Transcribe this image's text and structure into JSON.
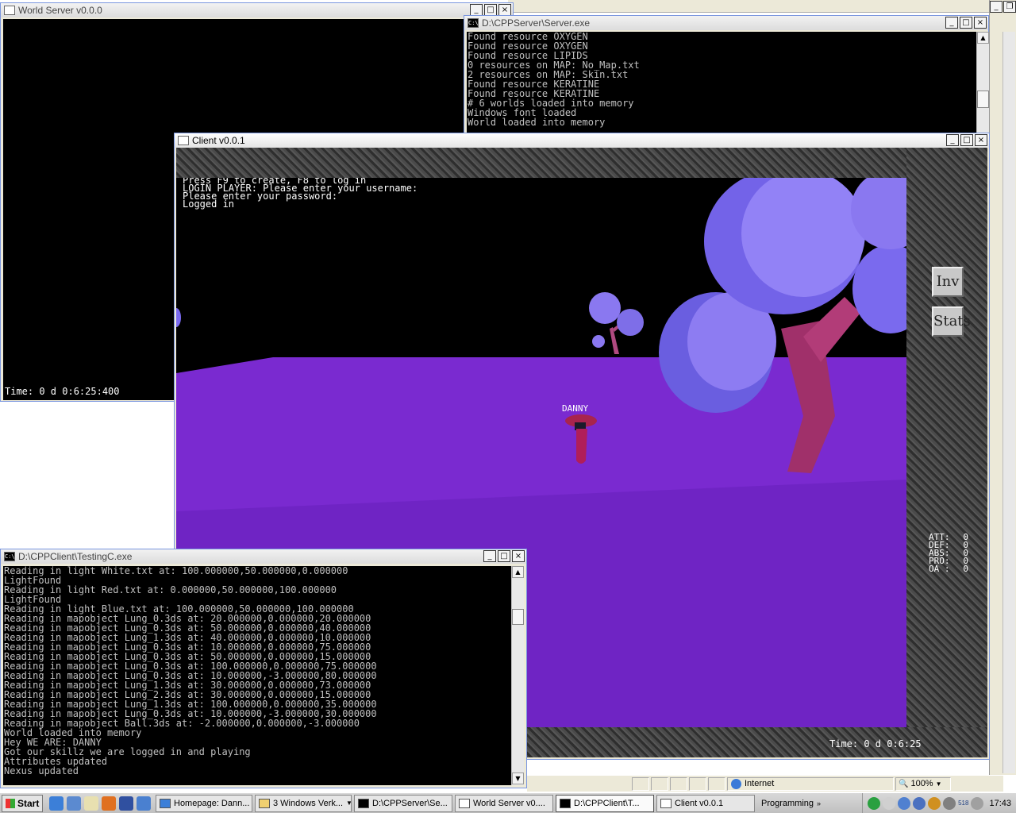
{
  "world_server": {
    "title": "World Server v0.0.0",
    "time_text": "Time: 0 d 0:6:25:400"
  },
  "server": {
    "title": "D:\\CPPServer\\Server.exe",
    "lines": [
      "Found resource OXYGEN",
      "Found resource OXYGEN",
      "Found resource LIPIDS",
      "0 resources on MAP: No_Map.txt",
      "2 resources on MAP: Skin.txt",
      "Found resource KERATINE",
      "Found resource KERATINE",
      "# 6 worlds loaded into memory",
      "Windows font loaded",
      "World loaded into memory"
    ]
  },
  "client": {
    "title": "Client v0.0.1",
    "hud_lines": [
      "Press F9 to create, F8 to log in",
      "Press F9 to create, F8 to log in",
      "LOGIN PLAYER: Please enter your username:",
      "Please enter your password:",
      "Logged in"
    ],
    "player_name": "DANNY",
    "inv_label": "Inv",
    "stats_label": "Stats",
    "stats": [
      {
        "label": "ATT:",
        "value": "0"
      },
      {
        "label": "DEF:",
        "value": "0"
      },
      {
        "label": "ABS:",
        "value": "0"
      },
      {
        "label": "PRO:",
        "value": "0"
      },
      {
        "label": "OA :",
        "value": "0"
      }
    ],
    "time_text": "Time: 0 d 0:6:25"
  },
  "testing_client": {
    "title": "D:\\CPPClient\\TestingC.exe",
    "lines": [
      "Reading in light White.txt at: 100.000000,50.000000,0.000000",
      "LightFound",
      "Reading in light Red.txt at: 0.000000,50.000000,100.000000",
      "LightFound",
      "Reading in light Blue.txt at: 100.000000,50.000000,100.000000",
      "Reading in mapobject Lung_0.3ds at: 20.000000,0.000000,20.000000",
      "Reading in mapobject Lung_0.3ds at: 50.000000,0.000000,40.000000",
      "Reading in mapobject Lung_1.3ds at: 40.000000,0.000000,10.000000",
      "Reading in mapobject Lung_0.3ds at: 10.000000,0.000000,75.000000",
      "Reading in mapobject Lung_0.3ds at: 50.000000,0.000000,15.000000",
      "Reading in mapobject Lung_0.3ds at: 100.000000,0.000000,75.000000",
      "Reading in mapobject Lung_0.3ds at: 10.000000,-3.000000,80.000000",
      "Reading in mapobject Lung_1.3ds at: 30.000000,0.000000,73.000000",
      "Reading in mapobject Lung_2.3ds at: 30.000000,0.000000,15.000000",
      "Reading in mapobject Lung_1.3ds at: 100.000000,0.000000,35.000000",
      "Reading in mapobject Lung_0.3ds at: 10.000000,-3.000000,30.000000",
      "Reading in mapobject Ball.3ds at: -2.000000,0.000000,-3.000000",
      "World loaded into memory",
      "Hey WE ARE: DANNY",
      "Got our skillz we are logged in and playing",
      "Attributes updated",
      "Nexus updated"
    ]
  },
  "browser_status": {
    "zone": "Internet",
    "zoom": "100%"
  },
  "taskbar": {
    "start_label": "Start",
    "tasks": [
      {
        "label": "Homepage: Dann...",
        "active": false
      },
      {
        "label": "3 Windows Verk...",
        "active": false
      },
      {
        "label": "D:\\CPPServer\\Se...",
        "active": false
      },
      {
        "label": "World Server v0....",
        "active": false
      },
      {
        "label": "D:\\CPPClient\\T...",
        "active": true
      },
      {
        "label": "Client v0.0.1",
        "active": false
      }
    ],
    "toolbar_label": "Programming",
    "tray_number": "518",
    "clock": "17:43"
  },
  "colors": {
    "terrain": "#7a2ad0",
    "sky": "#000000",
    "tree_canopy": "#8a78f0",
    "tree_trunk": "#a0306a"
  }
}
